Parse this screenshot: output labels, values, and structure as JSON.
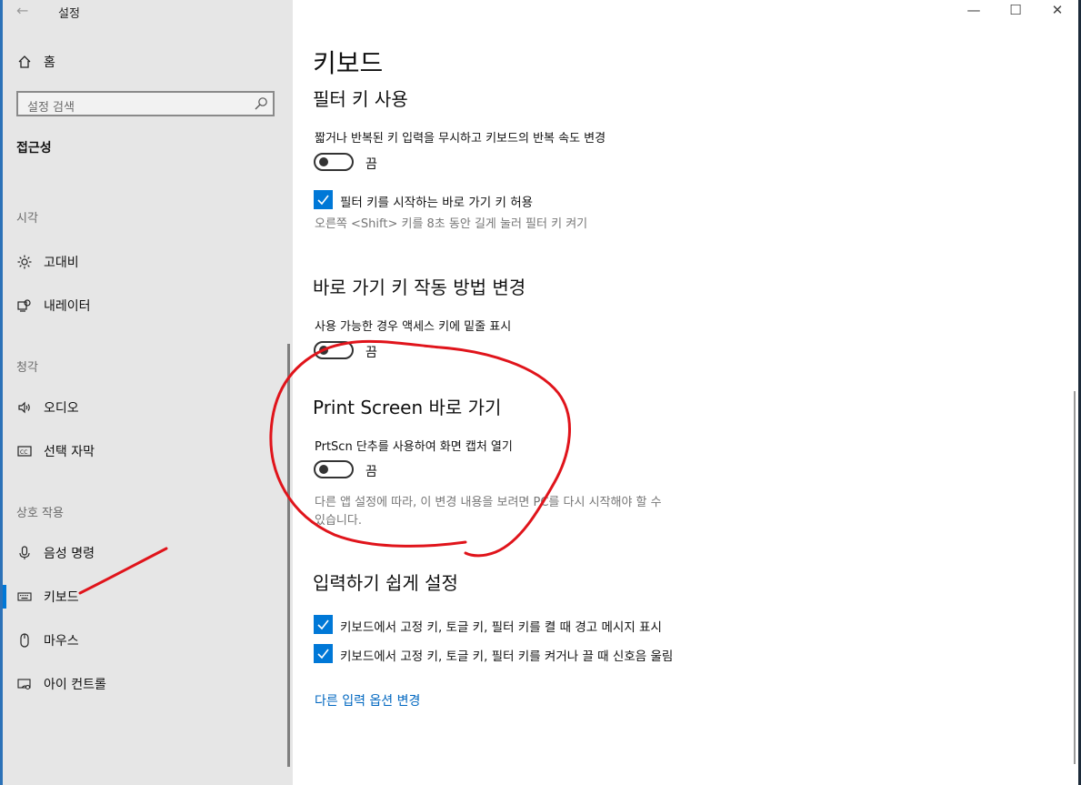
{
  "window": {
    "title": "설정",
    "back_icon": "back-arrow-icon",
    "controls": [
      "minimize-icon",
      "maximize-icon",
      "close-icon"
    ]
  },
  "sidebar": {
    "home_label": "홈",
    "search_placeholder": "설정 검색",
    "section_title": "접근성",
    "categories": {
      "vision": "시각",
      "hearing": "청각",
      "interaction": "상호 작용"
    },
    "items": [
      {
        "label": "고대비",
        "icon": "contrast-sun-icon"
      },
      {
        "label": "내레이터",
        "icon": "narrator-icon"
      },
      {
        "label": "오디오",
        "icon": "speaker-icon"
      },
      {
        "label": "선택 자막",
        "icon": "closed-caption-icon"
      },
      {
        "label": "음성 명령",
        "icon": "microphone-icon"
      },
      {
        "label": "키보드",
        "icon": "keyboard-icon",
        "active": true
      },
      {
        "label": "마우스",
        "icon": "mouse-icon"
      },
      {
        "label": "아이 컨트롤",
        "icon": "eye-control-icon"
      }
    ]
  },
  "main": {
    "page_title": "키보드",
    "filter_keys": {
      "heading": "필터 키 사용",
      "description": "짧거나 반복된 키 입력을 무시하고 키보드의 반복 속도 변경",
      "toggle_state": "끔",
      "checkbox_label": "필터 키를 시작하는 바로 가기 키 허용",
      "hint": "오른쪽 <Shift> 키를 8초 동안 길게 눌러 필터 키 켜기"
    },
    "shortcut_keys": {
      "heading": "바로 가기 키 작동 방법 변경",
      "description": "사용 가능한 경우 액세스 키에 밑줄 표시",
      "toggle_state": "끔"
    },
    "print_screen": {
      "heading": "Print Screen 바로 가기",
      "description": "PrtScn 단추를 사용하여 화면 캡처 열기",
      "toggle_state": "끔",
      "note_line1": "다른 앱 설정에 따라, 이 변경 내용을 보려면 PC를 다시 시작해야 할 수",
      "note_line2": "있습니다."
    },
    "ease_of_typing": {
      "heading": "입력하기 쉽게 설정",
      "check1": "키보드에서 고정 키, 토글 키, 필터 키를 켤 때 경고 메시지 표시",
      "check2": "키보드에서 고정 키, 토글 키, 필터 키를 켜거나 끌 때 신호음 울림"
    },
    "link": "다른 입력 옵션 변경"
  },
  "colors": {
    "accent": "#0078d7",
    "sidebar_bg": "#e6e6e6",
    "link": "#0067c0",
    "annotation": "#e0141b"
  }
}
